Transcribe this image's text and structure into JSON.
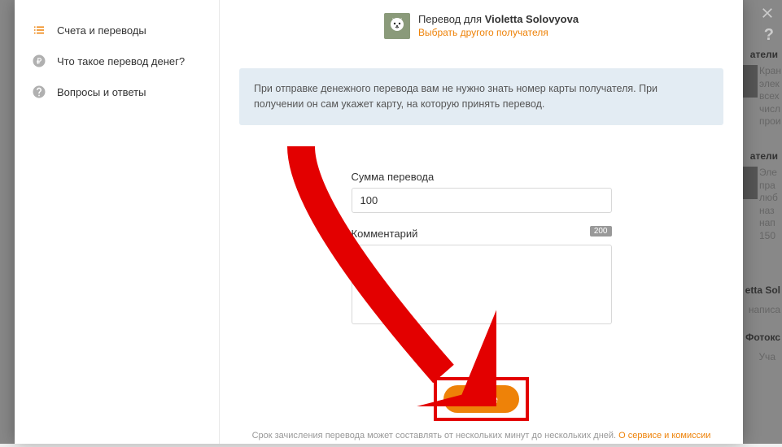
{
  "sidebar": {
    "items": [
      {
        "label": "Счета и переводы"
      },
      {
        "label": "Что такое перевод денег?"
      },
      {
        "label": "Вопросы и ответы"
      }
    ]
  },
  "header": {
    "title_prefix": "Перевод для ",
    "recipient_name": "Violetta Solovyova",
    "change_link": "Выбрать другого получателя"
  },
  "info_box": "При отправке денежного перевода вам не нужно знать номер карты получателя. При получении он сам укажет карту, на которую принять перевод.",
  "form": {
    "amount_label": "Сумма перевода",
    "amount_value": "100",
    "comment_label": "Комментарий",
    "comment_char_limit": "200",
    "submit_label": "Далее"
  },
  "footer": {
    "note": "Срок зачисления перевода может составлять от нескольких минут до нескольких дней. ",
    "link": "О сервисе и комиссии"
  },
  "bg_snips": {
    "s1": "атели",
    "s2": "Кран\nэлек\nвсех\nчисл\nпрои",
    "s3": "атели",
    "s4": "Эле\nпра\nлюб\nназ\nнап\n150",
    "s5": "etta Sol",
    "s6": "написа",
    "s7": "Фотокс",
    "s8": "Уча"
  }
}
